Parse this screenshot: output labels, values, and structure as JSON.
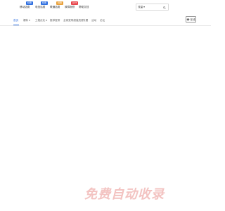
{
  "header": {
    "links": [
      {
        "label": "移动话费",
        "badge": "特惠",
        "badge_color": "#2f6fe0"
      },
      {
        "label": "电信话费",
        "badge": "特惠",
        "badge_color": "#2f6fe0"
      },
      {
        "label": "联通话费",
        "badge": "特惠",
        "badge_color": "#e9a13b"
      },
      {
        "label": "故障报修",
        "badge": "HOT",
        "badge_color": "#e8454b"
      },
      {
        "label": "帮助文档",
        "badge": ""
      }
    ],
    "search": {
      "selected": "流量 ▾",
      "icon": "search-icon"
    }
  },
  "subnav": {
    "items": [
      {
        "label": "首页",
        "active": true
      },
      {
        "label": "爆料 ▾",
        "active": false
      },
      {
        "label": "工程优化 ▾",
        "active": false
      },
      {
        "label": "推荐宽带",
        "active": false
      },
      {
        "label": "全家宽带超值资费",
        "active": false
      },
      {
        "label": "专题",
        "active": false
      },
      {
        "label": "活动",
        "active": false
      },
      {
        "label": "论坛",
        "active": false
      }
    ],
    "consult_label": "☎ 在线"
  },
  "watermark": "免费自动收录"
}
